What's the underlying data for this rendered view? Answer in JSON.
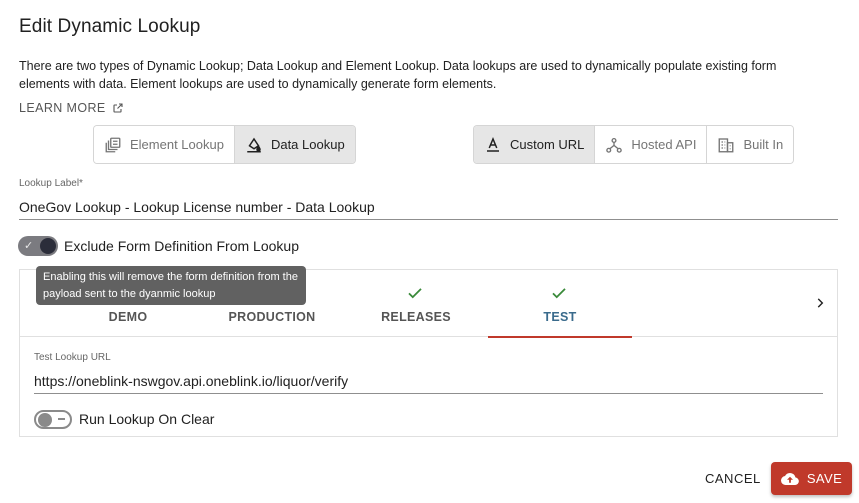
{
  "dialog": {
    "title": "Edit Dynamic Lookup",
    "intro": "There are two types of Dynamic Lookup; Data Lookup and Element Lookup. Data lookups are used to dynamically populate existing form elements with data. Element lookups are used to dynamically generate form elements.",
    "learn_more": "LEARN MORE"
  },
  "lookup_type": {
    "options": [
      {
        "label": "Element Lookup",
        "icon": "element-lookup-icon",
        "selected": false
      },
      {
        "label": "Data Lookup",
        "icon": "data-lookup-icon",
        "selected": true
      }
    ]
  },
  "lookup_source": {
    "options": [
      {
        "label": "Custom URL",
        "icon": "custom-url-icon",
        "selected": true
      },
      {
        "label": "Hosted API",
        "icon": "hosted-api-icon",
        "selected": false
      },
      {
        "label": "Built In",
        "icon": "built-in-icon",
        "selected": false
      }
    ]
  },
  "lookup_label": {
    "label": "Lookup Label*",
    "value": "OneGov Lookup - Lookup License number - Data Lookup"
  },
  "exclude_form_definition": {
    "label": "Exclude Form Definition From Lookup",
    "checked": true,
    "tooltip": "Enabling this will remove the form definition from the payload sent to the dyanmic lookup"
  },
  "environments": {
    "tabs": [
      {
        "label": "DEMO",
        "checked": false,
        "active": false
      },
      {
        "label": "PRODUCTION",
        "checked": false,
        "active": false
      },
      {
        "label": "RELEASES",
        "checked": true,
        "active": false
      },
      {
        "label": "TEST",
        "checked": true,
        "active": true
      }
    ],
    "test_lookup_url": {
      "label": "Test Lookup URL",
      "value": "https://oneblink-nswgov.api.oneblink.io/liquor/verify"
    },
    "run_lookup_on_clear": {
      "label": "Run Lookup On Clear",
      "checked": false
    }
  },
  "footer": {
    "cancel_label": "CANCEL",
    "save_label": "SAVE"
  },
  "colors": {
    "accent": "#c0392b",
    "active_tab_text": "#3a6b8c",
    "check_green": "#3a8a3a",
    "tooltip_bg": "#616161"
  }
}
